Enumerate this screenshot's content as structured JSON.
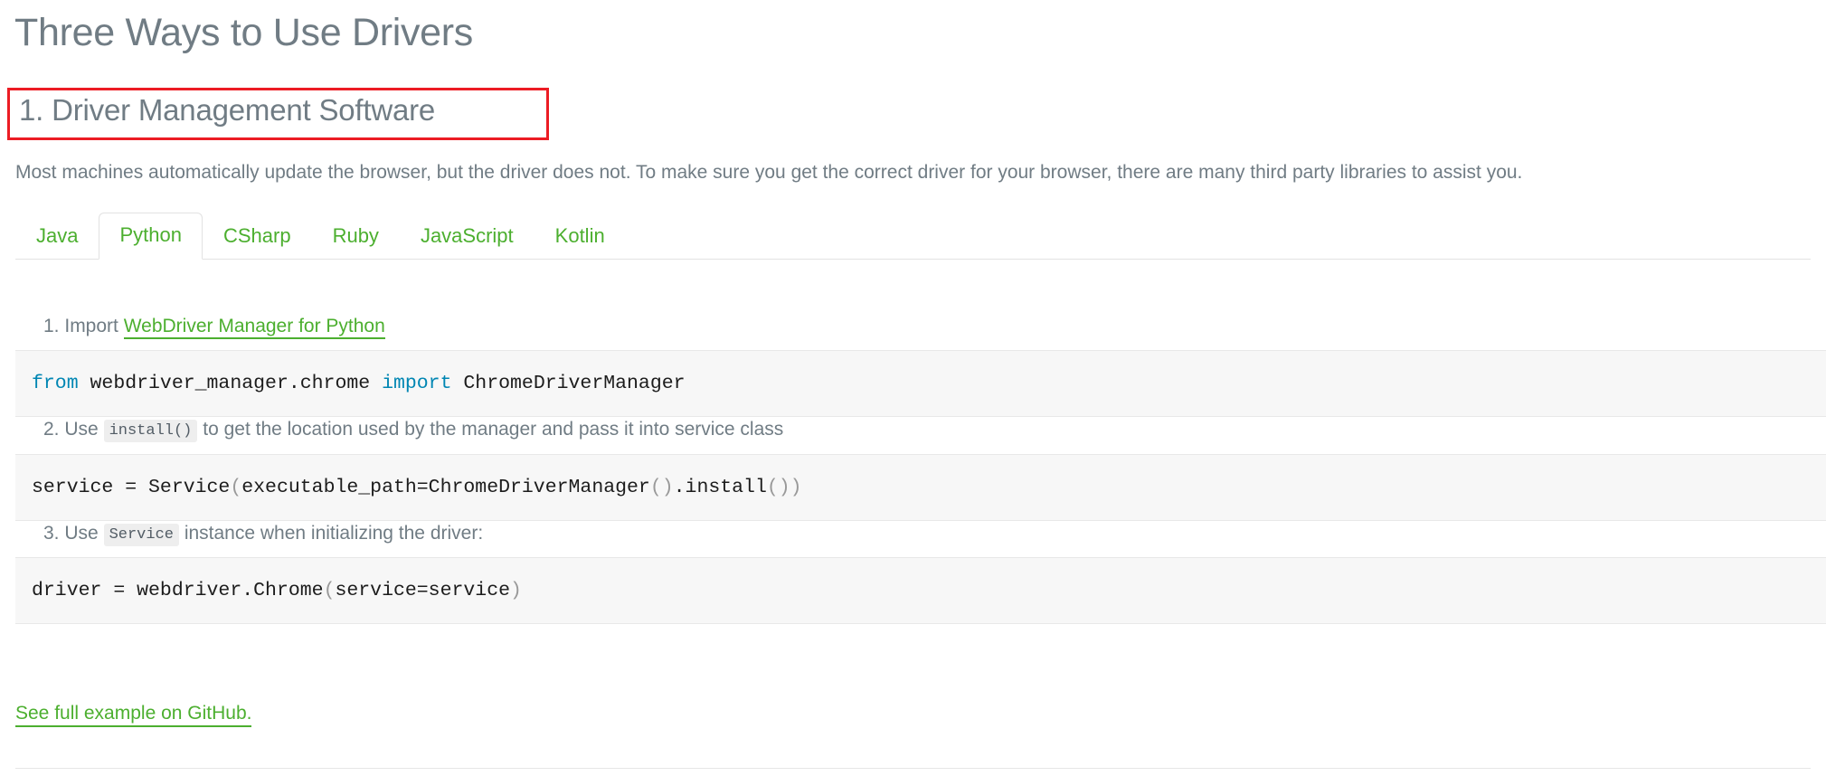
{
  "page": {
    "title": "Three Ways to Use Drivers",
    "section_heading": "1. Driver Management Software",
    "intro": "Most machines automatically update the browser, but the driver does not. To make sure you get the correct driver for your browser, there are many third party libraries to assist you.",
    "highlight_color": "#ec1c24",
    "link_color": "#4caf2f",
    "text_color": "#707c84"
  },
  "tabs": [
    {
      "label": "Java",
      "active": false
    },
    {
      "label": "Python",
      "active": true
    },
    {
      "label": "CSharp",
      "active": false
    },
    {
      "label": "Ruby",
      "active": false
    },
    {
      "label": "JavaScript",
      "active": false
    },
    {
      "label": "Kotlin",
      "active": false
    }
  ],
  "steps": {
    "one": {
      "number": "1.",
      "prefix": "Import",
      "link_text": "WebDriver Manager for Python"
    },
    "two": {
      "number": "2.",
      "prefix": "Use",
      "code": "install()",
      "suffix": "to get the location used by the manager and pass it into service class"
    },
    "three": {
      "number": "3.",
      "prefix": "Use",
      "code": "Service",
      "suffix": "instance when initializing the driver:"
    }
  },
  "code_blocks": {
    "block1": {
      "kw_from": "from",
      "module": " webdriver_manager.chrome ",
      "kw_import": "import",
      "symbol": " ChromeDriverManager"
    },
    "block2": {
      "part1": "service = Service",
      "open1": "(",
      "part2": "executable_path=ChromeDriverManager",
      "open2": "()",
      "dot": ".",
      "part3": "install",
      "close": "())"
    },
    "block3": {
      "part1": "driver = webdriver.Chrome",
      "open": "(",
      "part2": "service=service",
      "close": ")"
    }
  },
  "footer": {
    "github_link": "See full example on GitHub."
  }
}
